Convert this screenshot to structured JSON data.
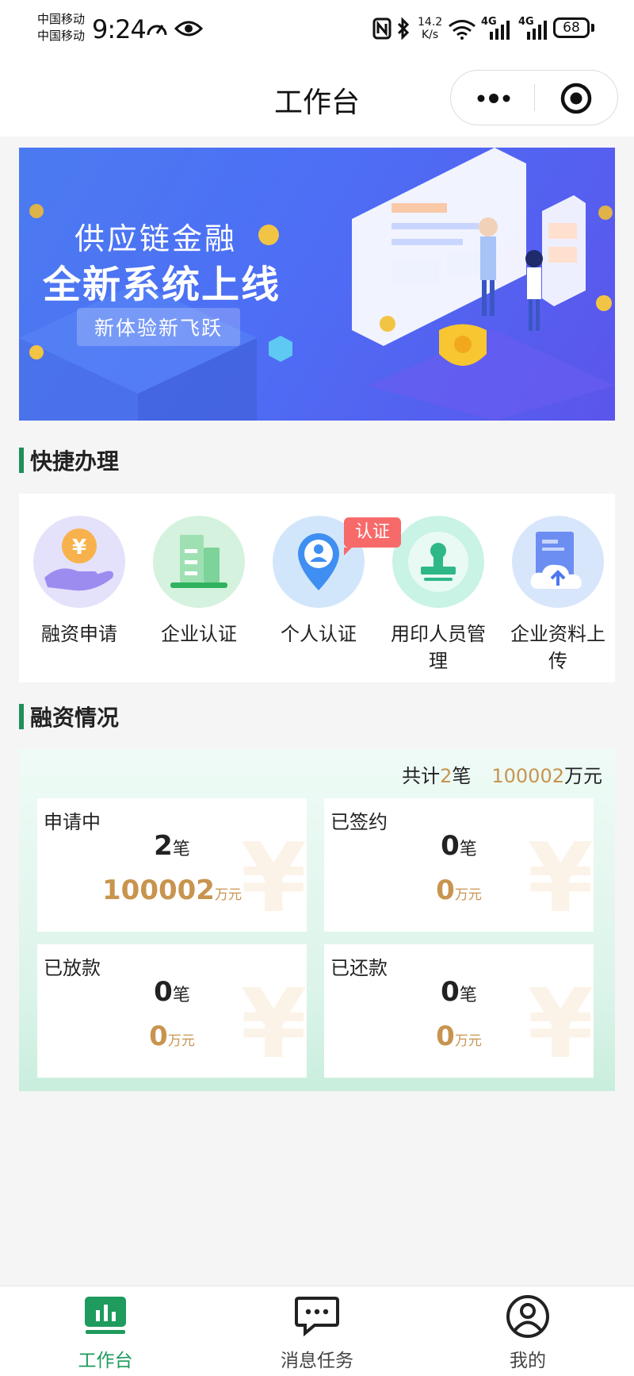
{
  "status_bar": {
    "carrier_1": "中国移动",
    "carrier_2": "中国移动",
    "time": "9:24",
    "net_speed_value": "14.2",
    "net_speed_unit": "K/s",
    "sim1_label": "4G",
    "sim2_label": "4G",
    "battery": "68"
  },
  "header": {
    "title": "工作台"
  },
  "banner": {
    "title": "供应链金融",
    "headline": "全新系统上线",
    "tagline": "新体验新飞跃"
  },
  "quick_actions": {
    "section_title": "快捷办理",
    "badge": "认证",
    "items": [
      {
        "label": "融资申请",
        "icon": "yen-hand-icon"
      },
      {
        "label": "企业认证",
        "icon": "building-icon"
      },
      {
        "label": "个人认证",
        "icon": "person-pin-icon"
      },
      {
        "label": "用印人员管理",
        "icon": "stamp-icon"
      },
      {
        "label": "企业资料上传",
        "icon": "cloud-upload-icon"
      }
    ]
  },
  "financing": {
    "section_title": "融资情况",
    "total_prefix": "共计",
    "total_count": "2",
    "total_count_unit": "笔",
    "total_amount": "100002",
    "total_amount_unit": "万元",
    "cards": [
      {
        "label": "申请中",
        "count": "2",
        "count_unit": "笔",
        "amount": "100002",
        "amount_unit": "万元"
      },
      {
        "label": "已签约",
        "count": "0",
        "count_unit": "笔",
        "amount": "0",
        "amount_unit": "万元"
      },
      {
        "label": "已放款",
        "count": "0",
        "count_unit": "笔",
        "amount": "0",
        "amount_unit": "万元"
      },
      {
        "label": "已还款",
        "count": "0",
        "count_unit": "笔",
        "amount": "0",
        "amount_unit": "万元"
      }
    ]
  },
  "tab_bar": {
    "items": [
      {
        "label": "工作台",
        "icon": "workbench-icon",
        "active": true
      },
      {
        "label": "消息任务",
        "icon": "message-icon",
        "active": false
      },
      {
        "label": "我的",
        "icon": "profile-icon",
        "active": false
      }
    ]
  },
  "colors": {
    "accent_green": "#1e9b5d",
    "gold": "#c8944e",
    "badge_red": "#f76a6a",
    "banner_blue": "#4d6ef5"
  }
}
